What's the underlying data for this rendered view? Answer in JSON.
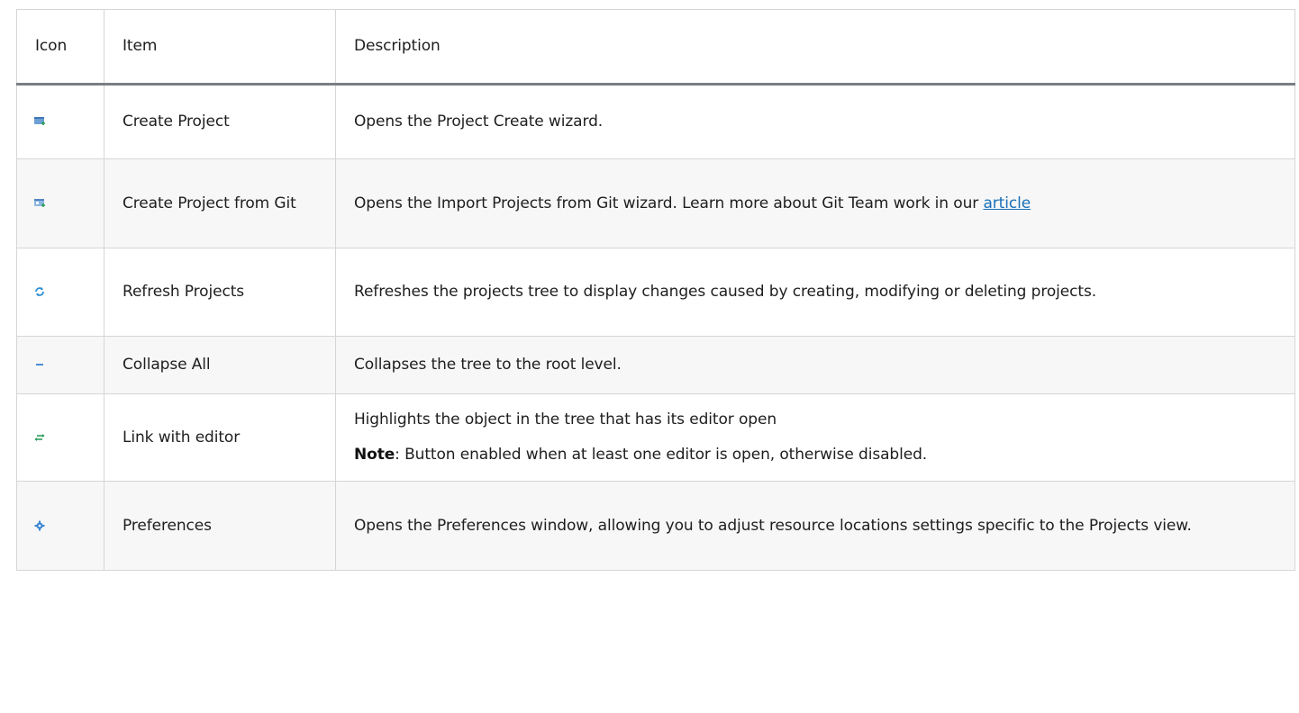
{
  "table": {
    "headers": {
      "icon": "Icon",
      "item": "Item",
      "description": "Description"
    },
    "rows": [
      {
        "icon": "create-project-icon",
        "item": "Create Project",
        "description": "Opens the Project Create wizard."
      },
      {
        "icon": "create-project-from-git-icon",
        "item": "Create Project from Git",
        "description": "Opens the Import Projects from Git wizard. Learn more about Git Team work in our ",
        "link_text": "article"
      },
      {
        "icon": "refresh-projects-icon",
        "item": "Refresh Projects",
        "description": "Refreshes the projects tree to display changes caused by creating, modifying or deleting projects."
      },
      {
        "icon": "collapse-all-icon",
        "item": "Collapse All",
        "description": "Collapses the tree to the root level."
      },
      {
        "icon": "link-with-editor-icon",
        "item": "Link with editor",
        "description": "Highlights the object in the tree that has its editor open",
        "note_label": "Note",
        "note_text": ": Button enabled when at least one editor is open, otherwise disabled."
      },
      {
        "icon": "preferences-gear-icon",
        "item": "Preferences",
        "description": "Opens the Preferences window, allowing you to adjust resource locations settings specific to the Projects view."
      }
    ]
  },
  "colors": {
    "link": "#1a6fb7",
    "border": "#d6d6d6",
    "header_rule": "#7b7e82",
    "stripe": "#f7f7f7"
  }
}
